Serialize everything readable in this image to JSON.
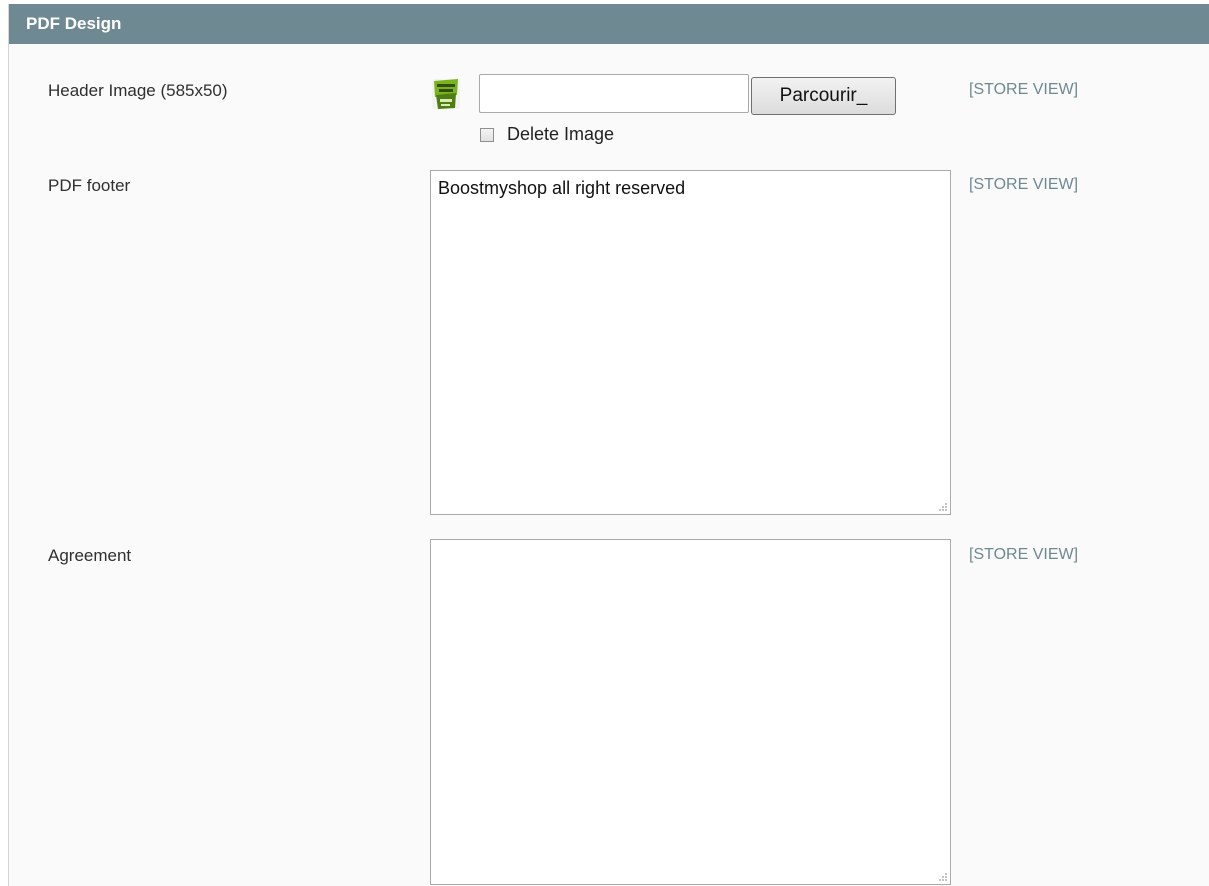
{
  "section": {
    "title": "PDF Design"
  },
  "fields": {
    "header_image": {
      "label": "Header Image (585x50)",
      "logo_icon": "boostmyshop-logo-icon",
      "file_value": "",
      "browse_label": "Parcourir_",
      "delete_label": "Delete Image",
      "delete_checked": false,
      "scope": "[STORE VIEW]"
    },
    "pdf_footer": {
      "label": "PDF footer",
      "value": "Boostmyshop all right reserved",
      "scope": "[STORE VIEW]"
    },
    "agreement": {
      "label": "Agreement",
      "value": "",
      "scope": "[STORE VIEW]"
    }
  },
  "colors": {
    "header_bg": "#6f8992",
    "scope_text": "#6f8992",
    "logo_green": "#7ab41d"
  }
}
